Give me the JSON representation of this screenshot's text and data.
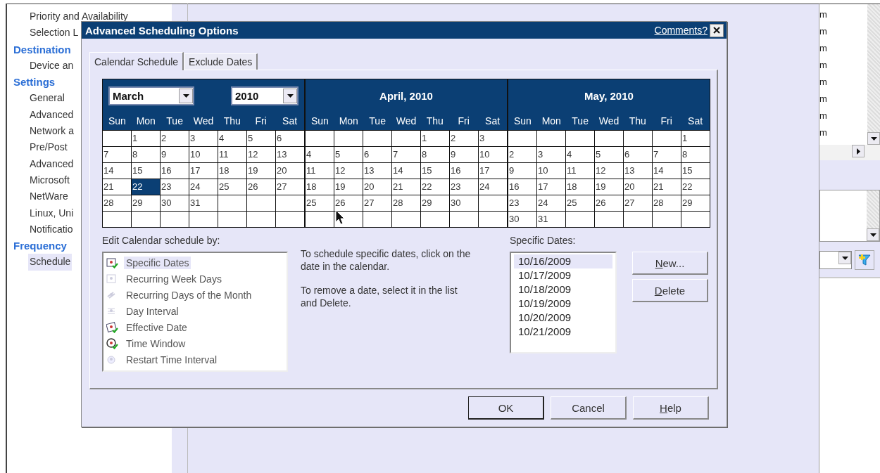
{
  "sidebar": {
    "items": [
      {
        "kind": "item",
        "label": "Priority and Availability",
        "selected": false
      },
      {
        "kind": "item",
        "label": "Selection L",
        "selected": false
      },
      {
        "kind": "category",
        "label": "Destination",
        "selected": false
      },
      {
        "kind": "item",
        "label": "Device an",
        "selected": false
      },
      {
        "kind": "category",
        "label": "Settings",
        "selected": false
      },
      {
        "kind": "item",
        "label": "General",
        "selected": false
      },
      {
        "kind": "item",
        "label": "Advanced",
        "selected": false
      },
      {
        "kind": "item",
        "label": "Network a",
        "selected": false
      },
      {
        "kind": "item",
        "label": "Pre/Post",
        "selected": false
      },
      {
        "kind": "item",
        "label": "Advanced",
        "selected": false
      },
      {
        "kind": "item",
        "label": "Microsoft",
        "selected": false
      },
      {
        "kind": "item",
        "label": "NetWare",
        "selected": false
      },
      {
        "kind": "item",
        "label": "Linux, Uni",
        "selected": false
      },
      {
        "kind": "item",
        "label": "Notificatio",
        "selected": false
      },
      {
        "kind": "category",
        "label": "Frequency",
        "selected": false
      },
      {
        "kind": "item",
        "label": "Schedule",
        "selected": true
      }
    ]
  },
  "right_list": {
    "items": [
      "m",
      "m",
      "m",
      "m",
      "m",
      "m",
      "m",
      "m"
    ]
  },
  "dialog": {
    "title": "Advanced Scheduling Options",
    "comments_link": "Comments?",
    "tabs": [
      {
        "label": "Calendar Schedule",
        "selected": true
      },
      {
        "label": "Exclude Dates",
        "selected": false
      }
    ],
    "calendar": {
      "months": [
        {
          "kind": "dropdowns",
          "month_select": "March",
          "year_select": "2010",
          "weekdays": [
            "Sun",
            "Mon",
            "Tue",
            "Wed",
            "Thu",
            "Fri",
            "Sat"
          ],
          "weeks": [
            {
              "kind": "first",
              "days": [
                {
                  "day": "1",
                  "selected": false
                },
                {
                  "day": "2",
                  "selected": false
                },
                {
                  "day": "3",
                  "selected": false
                },
                {
                  "day": "4",
                  "selected": false
                },
                {
                  "day": "5",
                  "selected": false
                },
                {
                  "day": "6",
                  "selected": false
                }
              ]
            },
            {
              "kind": "week",
              "days": [
                {
                  "day": "7",
                  "selected": false
                },
                {
                  "day": "8",
                  "selected": false
                },
                {
                  "day": "9",
                  "selected": false
                },
                {
                  "day": "10",
                  "selected": false
                },
                {
                  "day": "11",
                  "selected": false
                },
                {
                  "day": "12",
                  "selected": false
                },
                {
                  "day": "13",
                  "selected": false
                }
              ]
            },
            {
              "kind": "week",
              "days": [
                {
                  "day": "14",
                  "selected": false
                },
                {
                  "day": "15",
                  "selected": false
                },
                {
                  "day": "16",
                  "selected": false
                },
                {
                  "day": "17",
                  "selected": false
                },
                {
                  "day": "18",
                  "selected": false
                },
                {
                  "day": "19",
                  "selected": false
                },
                {
                  "day": "20",
                  "selected": false
                }
              ]
            },
            {
              "kind": "week",
              "days": [
                {
                  "day": "21",
                  "selected": false
                },
                {
                  "day": "22",
                  "selected": true
                },
                {
                  "day": "23",
                  "selected": false
                },
                {
                  "day": "24",
                  "selected": false
                },
                {
                  "day": "25",
                  "selected": false
                },
                {
                  "day": "26",
                  "selected": false
                },
                {
                  "day": "27",
                  "selected": false
                }
              ]
            },
            {
              "kind": "week",
              "days": [
                {
                  "day": "28",
                  "selected": false
                },
                {
                  "day": "29",
                  "selected": false
                },
                {
                  "day": "30",
                  "selected": false
                },
                {
                  "day": "31",
                  "selected": false
                }
              ]
            }
          ]
        },
        {
          "kind": "title",
          "title": "April, 2010",
          "weekdays": [
            "Sun",
            "Mon",
            "Tue",
            "Wed",
            "Thu",
            "Fri",
            "Sat"
          ],
          "weeks": [
            {
              "kind": "first",
              "days": [
                {
                  "day": "1",
                  "selected": false
                },
                {
                  "day": "2",
                  "selected": false
                },
                {
                  "day": "3",
                  "selected": false
                }
              ]
            },
            {
              "kind": "week",
              "days": [
                {
                  "day": "4",
                  "selected": false
                },
                {
                  "day": "5",
                  "selected": false
                },
                {
                  "day": "6",
                  "selected": false
                },
                {
                  "day": "7",
                  "selected": false
                },
                {
                  "day": "8",
                  "selected": false
                },
                {
                  "day": "9",
                  "selected": false
                },
                {
                  "day": "10",
                  "selected": false
                }
              ]
            },
            {
              "kind": "week",
              "days": [
                {
                  "day": "11",
                  "selected": false
                },
                {
                  "day": "12",
                  "selected": false
                },
                {
                  "day": "13",
                  "selected": false
                },
                {
                  "day": "14",
                  "selected": false
                },
                {
                  "day": "15",
                  "selected": false
                },
                {
                  "day": "16",
                  "selected": false
                },
                {
                  "day": "17",
                  "selected": false
                }
              ]
            },
            {
              "kind": "week",
              "days": [
                {
                  "day": "18",
                  "selected": false
                },
                {
                  "day": "19",
                  "selected": false
                },
                {
                  "day": "20",
                  "selected": false
                },
                {
                  "day": "21",
                  "selected": false
                },
                {
                  "day": "22",
                  "selected": false
                },
                {
                  "day": "23",
                  "selected": false
                },
                {
                  "day": "24",
                  "selected": false
                }
              ]
            },
            {
              "kind": "week",
              "days": [
                {
                  "day": "25",
                  "selected": false
                },
                {
                  "day": "26",
                  "selected": false
                },
                {
                  "day": "27",
                  "selected": false
                },
                {
                  "day": "28",
                  "selected": false
                },
                {
                  "day": "29",
                  "selected": false
                },
                {
                  "day": "30",
                  "selected": false
                }
              ]
            }
          ]
        },
        {
          "kind": "title",
          "title": "May, 2010",
          "weekdays": [
            "Sun",
            "Mon",
            "Tue",
            "Wed",
            "Thu",
            "Fri",
            "Sat"
          ],
          "weeks": [
            {
              "kind": "first",
              "days": [
                {
                  "day": "1",
                  "selected": false
                }
              ]
            },
            {
              "kind": "week",
              "days": [
                {
                  "day": "2",
                  "selected": false
                },
                {
                  "day": "3",
                  "selected": false
                },
                {
                  "day": "4",
                  "selected": false
                },
                {
                  "day": "5",
                  "selected": false
                },
                {
                  "day": "6",
                  "selected": false
                },
                {
                  "day": "7",
                  "selected": false
                },
                {
                  "day": "8",
                  "selected": false
                }
              ]
            },
            {
              "kind": "week",
              "days": [
                {
                  "day": "9",
                  "selected": false
                },
                {
                  "day": "10",
                  "selected": false
                },
                {
                  "day": "11",
                  "selected": false
                },
                {
                  "day": "12",
                  "selected": false
                },
                {
                  "day": "13",
                  "selected": false
                },
                {
                  "day": "14",
                  "selected": false
                },
                {
                  "day": "15",
                  "selected": false
                }
              ]
            },
            {
              "kind": "week",
              "days": [
                {
                  "day": "16",
                  "selected": false
                },
                {
                  "day": "17",
                  "selected": false
                },
                {
                  "day": "18",
                  "selected": false
                },
                {
                  "day": "19",
                  "selected": false
                },
                {
                  "day": "20",
                  "selected": false
                },
                {
                  "day": "21",
                  "selected": false
                },
                {
                  "day": "22",
                  "selected": false
                }
              ]
            },
            {
              "kind": "week",
              "days": [
                {
                  "day": "23",
                  "selected": false
                },
                {
                  "day": "24",
                  "selected": false
                },
                {
                  "day": "25",
                  "selected": false
                },
                {
                  "day": "26",
                  "selected": false
                },
                {
                  "day": "27",
                  "selected": false
                },
                {
                  "day": "28",
                  "selected": false
                },
                {
                  "day": "29",
                  "selected": false
                }
              ]
            },
            {
              "kind": "week",
              "days": [
                {
                  "day": "30",
                  "selected": false
                },
                {
                  "day": "31",
                  "selected": false
                }
              ]
            }
          ]
        }
      ]
    },
    "edit_by": {
      "label": "Edit Calendar schedule by:",
      "items": [
        {
          "kind": "calendar",
          "label": "Specific Dates",
          "active": true,
          "selected": true
        },
        {
          "kind": "week",
          "label": "Recurring Week Days",
          "active": false,
          "selected": false
        },
        {
          "kind": "month",
          "label": "Recurring Days of the Month",
          "active": false,
          "selected": false
        },
        {
          "kind": "interval",
          "label": "Day Interval",
          "active": false,
          "selected": false
        },
        {
          "kind": "effective",
          "label": "Effective Date",
          "active": true,
          "selected": false
        },
        {
          "kind": "clock",
          "label": "Time Window",
          "active": true,
          "selected": false
        },
        {
          "kind": "restart",
          "label": "Restart Time Interval",
          "active": false,
          "selected": false
        }
      ]
    },
    "instructions": [
      "To schedule specific dates, click on the date in the calendar.",
      "To remove a date, select it in the list and Delete."
    ],
    "specific_dates": {
      "label": "Specific Dates:",
      "items": [
        {
          "label": "10/16/2009",
          "selected": true
        },
        {
          "label": "10/17/2009",
          "selected": false
        },
        {
          "label": "10/18/2009",
          "selected": false
        },
        {
          "label": "10/19/2009",
          "selected": false
        },
        {
          "label": "10/20/2009",
          "selected": false
        },
        {
          "label": "10/21/2009",
          "selected": false
        }
      ]
    },
    "side_buttons": [
      {
        "label": "New...",
        "underline_first": true
      },
      {
        "label": "Delete",
        "underline_first": true
      }
    ],
    "footer_buttons": [
      {
        "label": "OK",
        "underline_first": false,
        "default": true
      },
      {
        "label": "Cancel",
        "underline_first": false,
        "default": false
      },
      {
        "label": "Help",
        "underline_first": true,
        "default": false
      }
    ]
  }
}
